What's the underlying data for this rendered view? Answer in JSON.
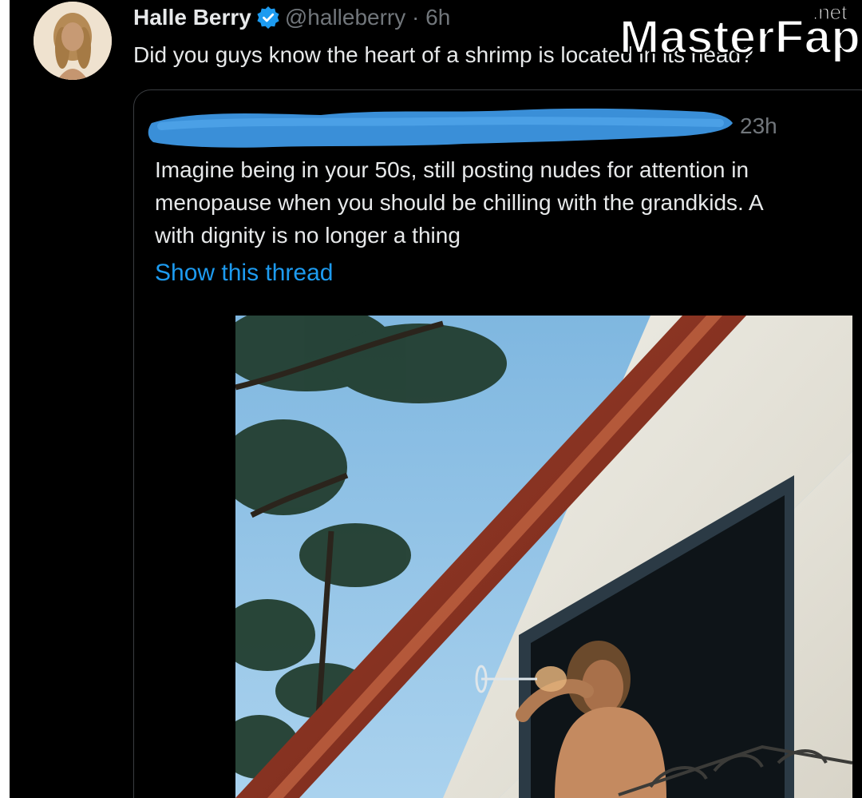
{
  "tweet": {
    "author_name": "Halle Berry",
    "author_handle": "@halleberry",
    "separator": "·",
    "time": "6h",
    "text": "Did you guys know the heart of a shrimp is located in its head?"
  },
  "quoted_tweet": {
    "time": "23h",
    "lines": [
      "Imagine being in your 50s, still posting nudes for attention in",
      "menopause when you should be chilling with the grandkids. A",
      "with dignity is no longer a thing"
    ],
    "show_thread_label": "Show this thread"
  },
  "watermark": {
    "brand_text": "MasterFap",
    "tld_text": ".net"
  },
  "colors": {
    "background": "#000000",
    "text": "#e7e9ea",
    "muted": "#71767b",
    "link": "#1d9bf0",
    "verified": "#1d9bf0",
    "redaction": "#3a8fd8"
  },
  "icons": {
    "verified": "verified-badge-icon"
  }
}
